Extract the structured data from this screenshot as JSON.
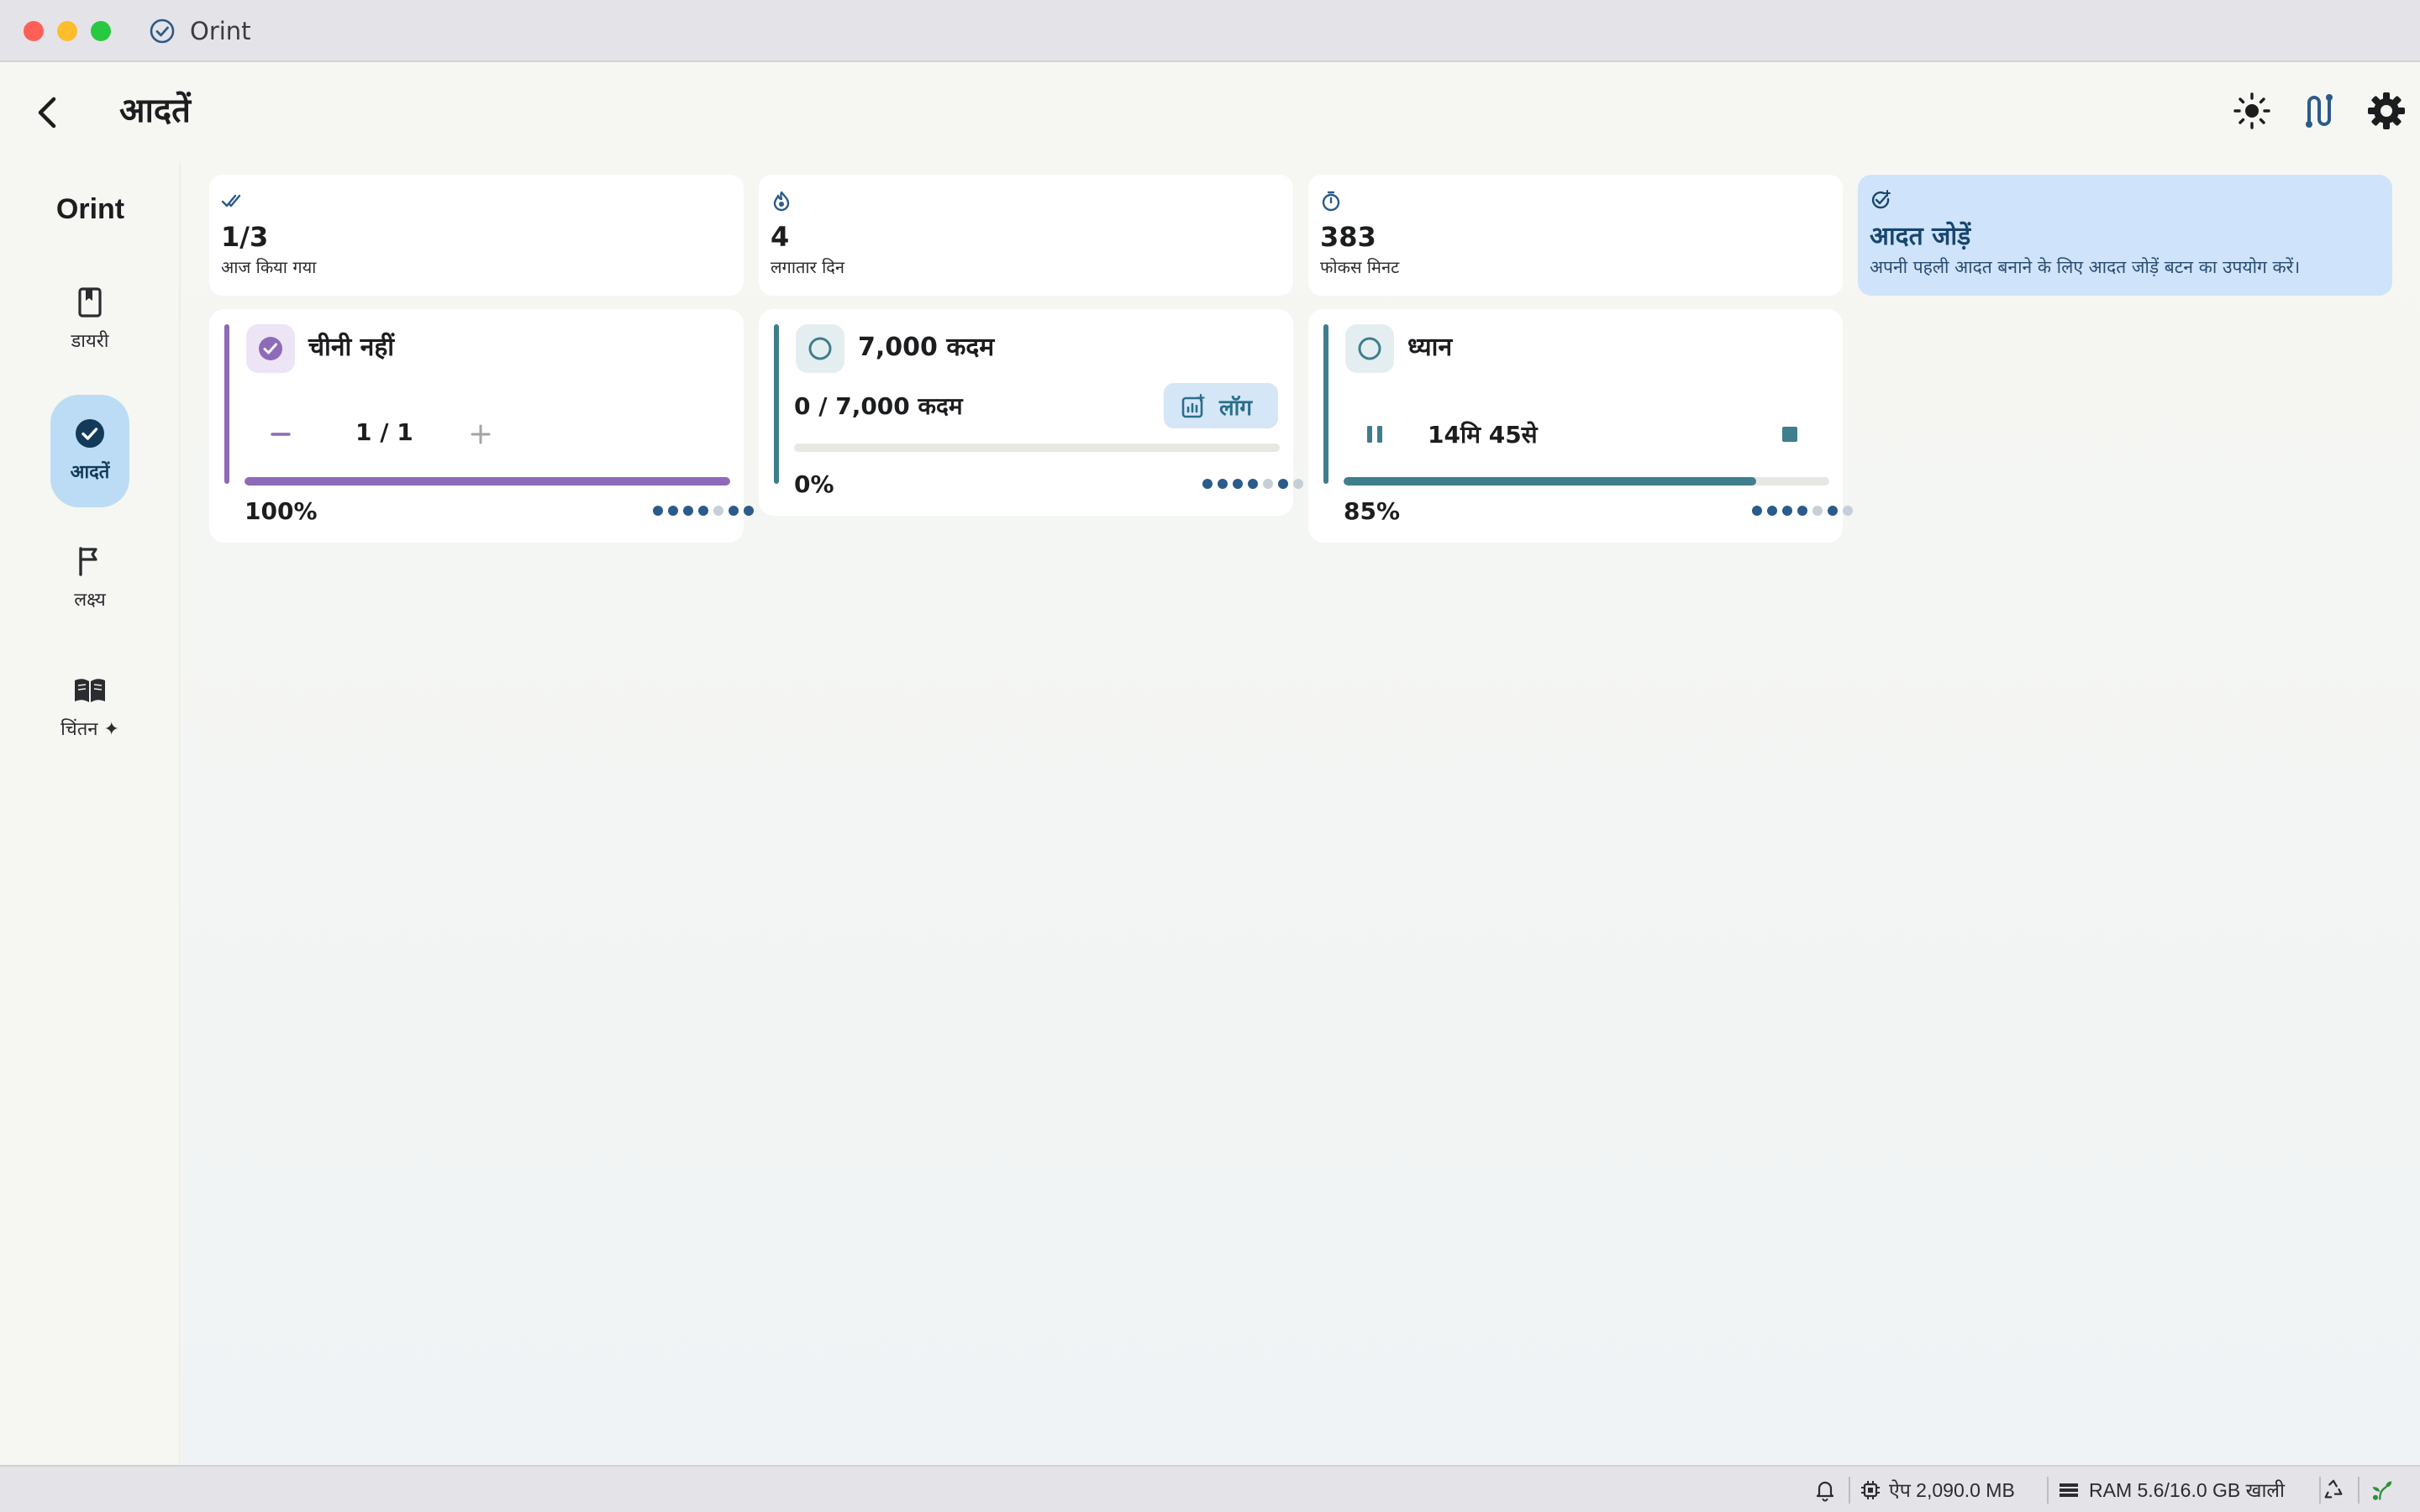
{
  "window": {
    "title": "Orint"
  },
  "header": {
    "title": "आदतें"
  },
  "sidebar": {
    "brand": "Orint",
    "items": [
      {
        "label": "डायरी",
        "icon": "journal-icon"
      },
      {
        "label": "आदतें",
        "icon": "check-circle-icon",
        "active": true
      },
      {
        "label": "लक्ष्य",
        "icon": "flag-icon"
      },
      {
        "label": "चिंतन ✦",
        "icon": "book-open-icon"
      }
    ]
  },
  "stats": [
    {
      "value": "1/3",
      "label": "आज किया गया",
      "icon": "double-check-icon"
    },
    {
      "value": "4",
      "label": "लगातार दिन",
      "icon": "flame-icon"
    },
    {
      "value": "383",
      "label": "फोकस मिनट",
      "icon": "timer-icon"
    }
  ],
  "add_habit": {
    "title": "आदत जोड़ें",
    "hint": "अपनी पहली आदत बनाने के लिए आदत जोड़ें बटन का उपयोग करें।",
    "icon": "add-check-icon"
  },
  "habits": [
    {
      "name": "चीनी नहीं",
      "type": "counter",
      "count": "1 / 1",
      "progress": 1.0,
      "percent": "100%",
      "color": "#8e6bb8",
      "done": true,
      "week": [
        1,
        1,
        1,
        1,
        0,
        1,
        1
      ]
    },
    {
      "name": "7,000 कदम",
      "type": "log",
      "count_text": "0 / 7,000 कदम",
      "log_label": "लॉग",
      "progress": 0.0,
      "percent": "0%",
      "color": "#3f7e8c",
      "done": false,
      "week": [
        1,
        1,
        1,
        1,
        0,
        1,
        0
      ]
    },
    {
      "name": "ध्यान",
      "type": "timer",
      "timer": "14मि 45से",
      "progress": 0.85,
      "percent": "85%",
      "color": "#3f7e8c",
      "done": false,
      "week": [
        1,
        1,
        1,
        1,
        0,
        1,
        0
      ]
    }
  ],
  "status_bar": {
    "app_memory": "ऐप 2,090.0 MB",
    "ram": "RAM 5.6/16.0 GB खाली"
  }
}
